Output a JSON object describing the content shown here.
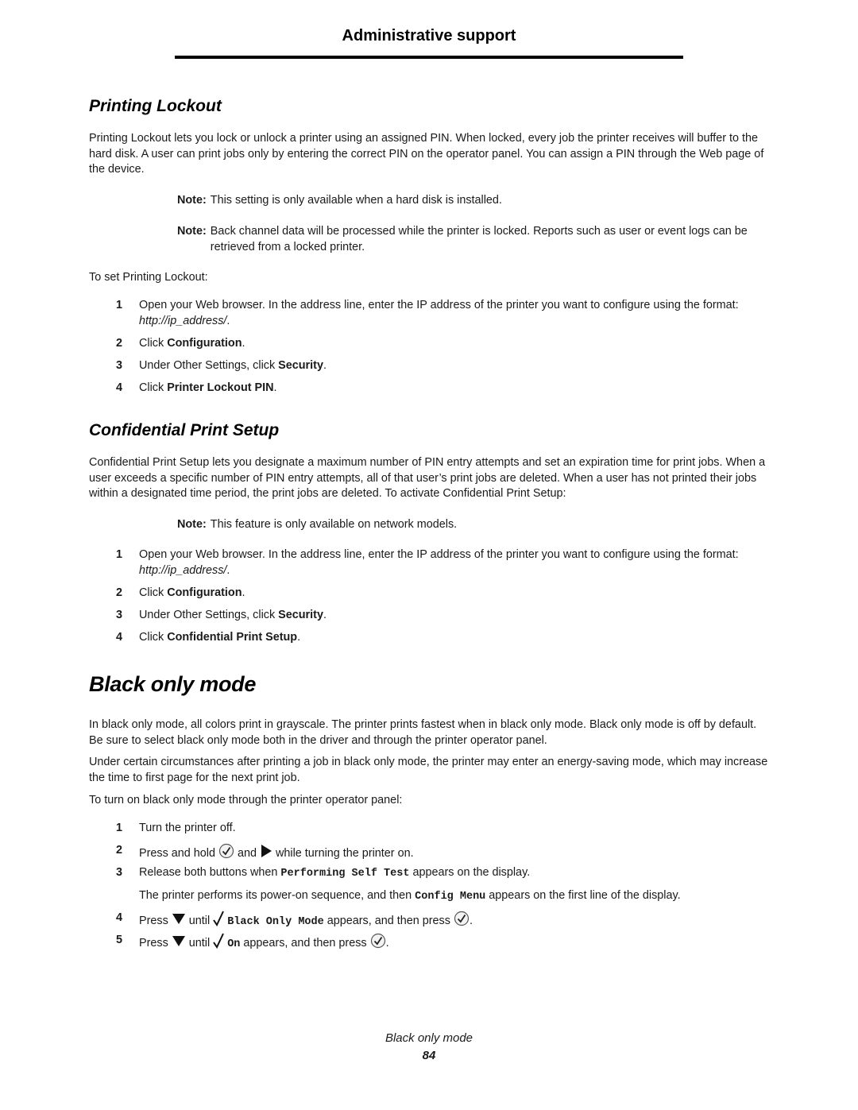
{
  "header": {
    "title": "Administrative support"
  },
  "printing_lockout": {
    "heading": "Printing Lockout",
    "intro": "Printing Lockout lets you lock or unlock a printer using an assigned PIN. When locked, every job the printer receives will buffer to the hard disk. A user can print jobs only by entering the correct PIN on the operator panel. You can assign a PIN through the Web page of the device.",
    "notes": [
      {
        "label": "Note:",
        "text": "This setting is only available when a hard disk is installed."
      },
      {
        "label": "Note:",
        "text": "Back channel data will be processed while the printer is locked. Reports such as user or event logs can be retrieved from a locked printer."
      }
    ],
    "lead": "To set Printing Lockout:",
    "steps": [
      {
        "num": "1",
        "pre": "Open your Web browser. In the address line, enter the IP address of the printer you want to configure using the format: ",
        "em": "http://ip_address/",
        "post": "."
      },
      {
        "num": "2",
        "pre": "Click ",
        "strong": "Configuration",
        "post": "."
      },
      {
        "num": "3",
        "pre": "Under Other Settings, click ",
        "strong": "Security",
        "post": "."
      },
      {
        "num": "4",
        "pre": "Click ",
        "strong": "Printer Lockout PIN",
        "post": "."
      }
    ]
  },
  "confidential_print": {
    "heading": "Confidential Print Setup",
    "intro": "Confidential Print Setup lets you designate a maximum number of PIN entry attempts and set an expiration time for print jobs. When a user exceeds a specific number of PIN entry attempts, all of that user’s print jobs are deleted. When a user has not printed their jobs within a designated time period, the print jobs are deleted. To activate Confidential Print Setup:",
    "note": {
      "label": "Note:",
      "text": "This feature is only available on network models."
    },
    "steps": [
      {
        "num": "1",
        "pre": "Open your Web browser. In the address line, enter the IP address of the printer you want to configure using the format: ",
        "em": "http://ip_address/",
        "post": "."
      },
      {
        "num": "2",
        "pre": "Click ",
        "strong": "Configuration",
        "post": "."
      },
      {
        "num": "3",
        "pre": "Under Other Settings, click ",
        "strong": "Security",
        "post": "."
      },
      {
        "num": "4",
        "pre": "Click ",
        "strong": "Confidential Print Setup",
        "post": "."
      }
    ]
  },
  "black_only": {
    "heading": "Black only mode",
    "para1": "In black only mode, all colors print in grayscale. The printer prints fastest when in black only mode. Black only mode is off by default. Be sure to select black only mode both in the driver and through the printer operator panel.",
    "para2": "Under certain circumstances after printing a job in black only mode, the printer may enter an energy-saving mode, which may increase the time to first page for the next print job.",
    "lead": "To turn on black only mode through the printer operator panel:",
    "steps": [
      {
        "num": "1",
        "text": "Turn the printer off."
      },
      {
        "num": "2",
        "a": "Press and hold",
        "b": "and",
        "c": "while turning the printer on."
      },
      {
        "num": "3",
        "a": "Release both buttons when",
        "code": "Performing Self Test",
        "c": "appears on the display."
      },
      {
        "num": "4",
        "a": "Press",
        "b": "until",
        "code": "Black Only Mode",
        "c": "appears, and then press",
        "d": "."
      },
      {
        "num": "5",
        "a": "Press",
        "b": "until",
        "code": "On",
        "c": "appears, and then press",
        "d": "."
      }
    ],
    "step3_sub": {
      "a": "The printer performs its power-on sequence, and then",
      "code": "Config Menu",
      "c": "appears on the first line of the display."
    }
  },
  "footer": {
    "title": "Black only mode",
    "page": "84"
  }
}
